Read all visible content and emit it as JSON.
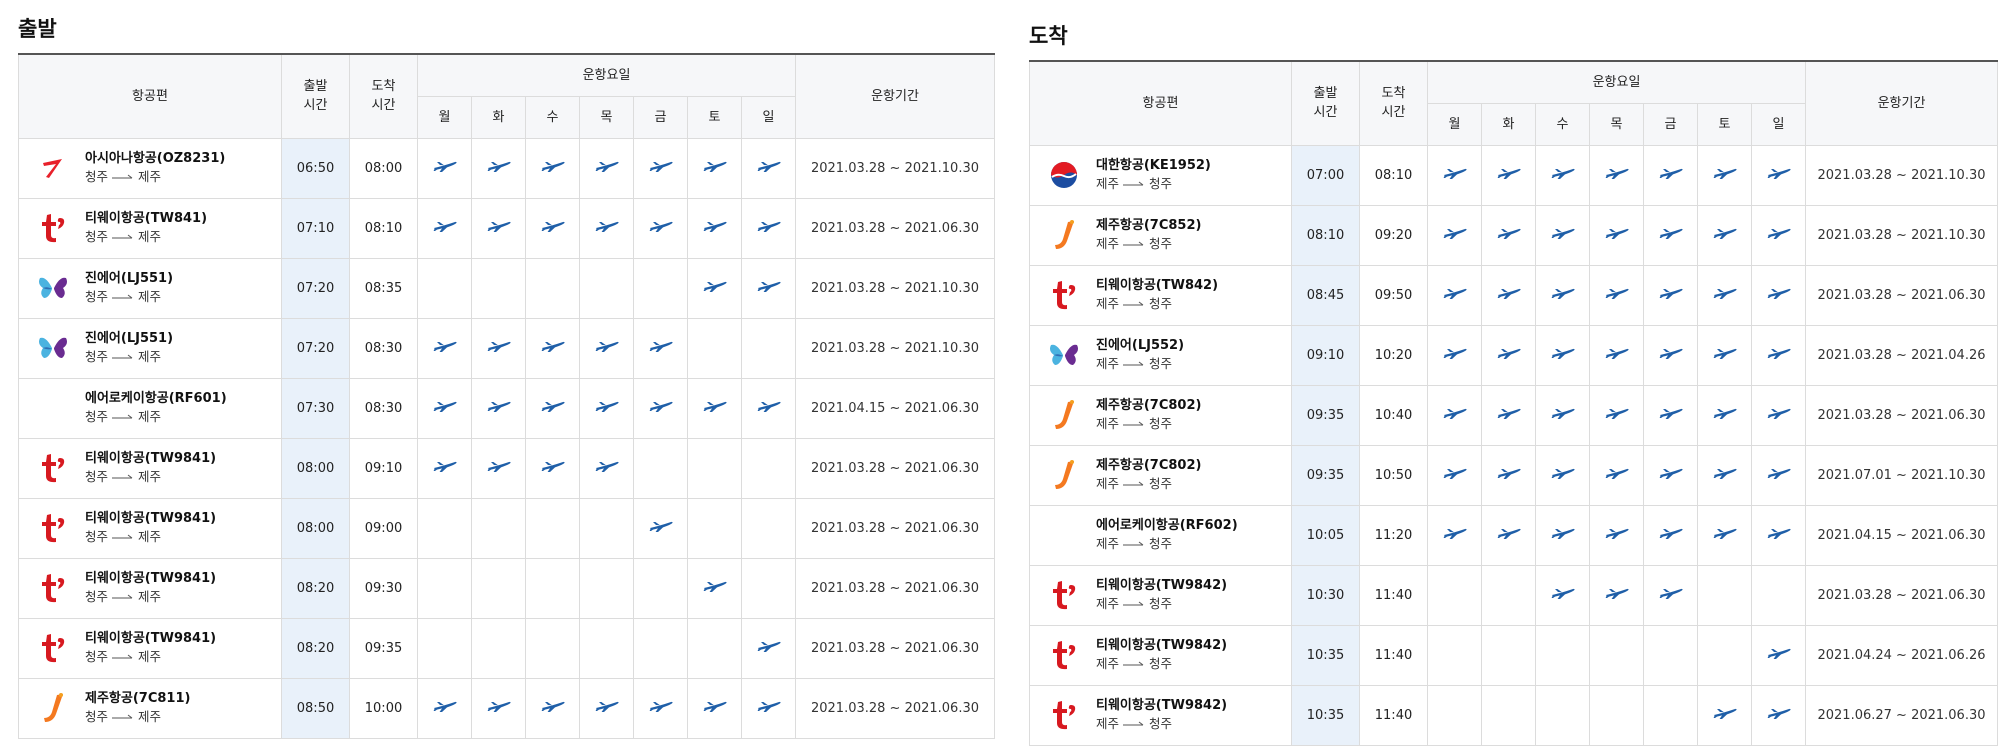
{
  "colors": {
    "plane": "#1f5fa8",
    "dep_time_bg": "#e9f1fa",
    "header_bg": "#f6f7f9",
    "asiana": "#e8202a",
    "tway": "#d71920",
    "jeju": "#f47920",
    "jinair": "#6a2c91",
    "korean_air_blue": "#1c4da1",
    "korean_air_red": "#e31b23"
  },
  "headers": {
    "airline": "항공편",
    "dep_time": "출발\n시간",
    "arr_time": "도착\n시간",
    "days_group": "운항요일",
    "days": [
      "월",
      "화",
      "수",
      "목",
      "금",
      "토",
      "일"
    ],
    "period": "운항기간"
  },
  "departure": {
    "title": "출발",
    "rows": [
      {
        "logo": "asiana-logo-icon",
        "airline": "아시아나항공(OZ8231)",
        "from": "청주",
        "to": "제주",
        "dep": "06:50",
        "arr": "08:00",
        "days": [
          1,
          1,
          1,
          1,
          1,
          1,
          1
        ],
        "period": "2021.03.28 ~ 2021.10.30"
      },
      {
        "logo": "tway-logo-icon",
        "airline": "티웨이항공(TW841)",
        "from": "청주",
        "to": "제주",
        "dep": "07:10",
        "arr": "08:10",
        "days": [
          1,
          1,
          1,
          1,
          1,
          1,
          1
        ],
        "period": "2021.03.28 ~ 2021.06.30"
      },
      {
        "logo": "jinair-logo-icon",
        "airline": "진에어(LJ551)",
        "from": "청주",
        "to": "제주",
        "dep": "07:20",
        "arr": "08:35",
        "days": [
          0,
          0,
          0,
          0,
          0,
          1,
          1
        ],
        "period": "2021.03.28 ~ 2021.10.30"
      },
      {
        "logo": "jinair-logo-icon",
        "airline": "진에어(LJ551)",
        "from": "청주",
        "to": "제주",
        "dep": "07:20",
        "arr": "08:30",
        "days": [
          1,
          1,
          1,
          1,
          1,
          0,
          0
        ],
        "period": "2021.03.28 ~ 2021.10.30"
      },
      {
        "logo": "",
        "airline": "에어로케이항공(RF601)",
        "from": "청주",
        "to": "제주",
        "dep": "07:30",
        "arr": "08:30",
        "days": [
          1,
          1,
          1,
          1,
          1,
          1,
          1
        ],
        "period": "2021.04.15 ~ 2021.06.30"
      },
      {
        "logo": "tway-logo-icon",
        "airline": "티웨이항공(TW9841)",
        "from": "청주",
        "to": "제주",
        "dep": "08:00",
        "arr": "09:10",
        "days": [
          1,
          1,
          1,
          1,
          0,
          0,
          0
        ],
        "period": "2021.03.28 ~ 2021.06.30"
      },
      {
        "logo": "tway-logo-icon",
        "airline": "티웨이항공(TW9841)",
        "from": "청주",
        "to": "제주",
        "dep": "08:00",
        "arr": "09:00",
        "days": [
          0,
          0,
          0,
          0,
          1,
          0,
          0
        ],
        "period": "2021.03.28 ~ 2021.06.30"
      },
      {
        "logo": "tway-logo-icon",
        "airline": "티웨이항공(TW9841)",
        "from": "청주",
        "to": "제주",
        "dep": "08:20",
        "arr": "09:30",
        "days": [
          0,
          0,
          0,
          0,
          0,
          1,
          0
        ],
        "period": "2021.03.28 ~ 2021.06.30"
      },
      {
        "logo": "tway-logo-icon",
        "airline": "티웨이항공(TW9841)",
        "from": "청주",
        "to": "제주",
        "dep": "08:20",
        "arr": "09:35",
        "days": [
          0,
          0,
          0,
          0,
          0,
          0,
          1
        ],
        "period": "2021.03.28 ~ 2021.06.30"
      },
      {
        "logo": "jeju-logo-icon",
        "airline": "제주항공(7C811)",
        "from": "청주",
        "to": "제주",
        "dep": "08:50",
        "arr": "10:00",
        "days": [
          1,
          1,
          1,
          1,
          1,
          1,
          1
        ],
        "period": "2021.03.28 ~ 2021.06.30"
      }
    ]
  },
  "arrival": {
    "title": "도착",
    "rows": [
      {
        "logo": "koreanair-logo-icon",
        "airline": "대한항공(KE1952)",
        "from": "제주",
        "to": "청주",
        "dep": "07:00",
        "arr": "08:10",
        "days": [
          1,
          1,
          1,
          1,
          1,
          1,
          1
        ],
        "period": "2021.03.28 ~ 2021.10.30"
      },
      {
        "logo": "jeju-logo-icon",
        "airline": "제주항공(7C852)",
        "from": "제주",
        "to": "청주",
        "dep": "08:10",
        "arr": "09:20",
        "days": [
          1,
          1,
          1,
          1,
          1,
          1,
          1
        ],
        "period": "2021.03.28 ~ 2021.10.30"
      },
      {
        "logo": "tway-logo-icon",
        "airline": "티웨이항공(TW842)",
        "from": "제주",
        "to": "청주",
        "dep": "08:45",
        "arr": "09:50",
        "days": [
          1,
          1,
          1,
          1,
          1,
          1,
          1
        ],
        "period": "2021.03.28 ~ 2021.06.30"
      },
      {
        "logo": "jinair-logo-icon",
        "airline": "진에어(LJ552)",
        "from": "제주",
        "to": "청주",
        "dep": "09:10",
        "arr": "10:20",
        "days": [
          1,
          1,
          1,
          1,
          1,
          1,
          1
        ],
        "period": "2021.03.28 ~ 2021.04.26"
      },
      {
        "logo": "jeju-logo-icon",
        "airline": "제주항공(7C802)",
        "from": "제주",
        "to": "청주",
        "dep": "09:35",
        "arr": "10:40",
        "days": [
          1,
          1,
          1,
          1,
          1,
          1,
          1
        ],
        "period": "2021.03.28 ~ 2021.06.30"
      },
      {
        "logo": "jeju-logo-icon",
        "airline": "제주항공(7C802)",
        "from": "제주",
        "to": "청주",
        "dep": "09:35",
        "arr": "10:50",
        "days": [
          1,
          1,
          1,
          1,
          1,
          1,
          1
        ],
        "period": "2021.07.01 ~ 2021.10.30"
      },
      {
        "logo": "",
        "airline": "에어로케이항공(RF602)",
        "from": "제주",
        "to": "청주",
        "dep": "10:05",
        "arr": "11:20",
        "days": [
          1,
          1,
          1,
          1,
          1,
          1,
          1
        ],
        "period": "2021.04.15 ~ 2021.06.30"
      },
      {
        "logo": "tway-logo-icon",
        "airline": "티웨이항공(TW9842)",
        "from": "제주",
        "to": "청주",
        "dep": "10:30",
        "arr": "11:40",
        "days": [
          0,
          0,
          1,
          1,
          1,
          0,
          0
        ],
        "period": "2021.03.28 ~ 2021.06.30"
      },
      {
        "logo": "tway-logo-icon",
        "airline": "티웨이항공(TW9842)",
        "from": "제주",
        "to": "청주",
        "dep": "10:35",
        "arr": "11:40",
        "days": [
          0,
          0,
          0,
          0,
          0,
          0,
          1
        ],
        "period": "2021.04.24 ~ 2021.06.26"
      },
      {
        "logo": "tway-logo-icon",
        "airline": "티웨이항공(TW9842)",
        "from": "제주",
        "to": "청주",
        "dep": "10:35",
        "arr": "11:40",
        "days": [
          0,
          0,
          0,
          0,
          0,
          1,
          1
        ],
        "period": "2021.06.27 ~ 2021.06.30"
      }
    ]
  }
}
